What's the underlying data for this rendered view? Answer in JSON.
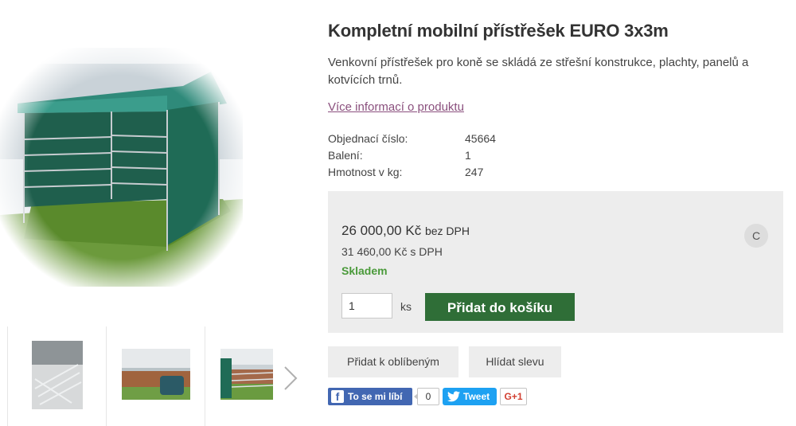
{
  "product": {
    "title": "Kompletní mobilní přístřešek EURO 3x3m",
    "description": "Venkovní přístřešek pro koně se skládá ze střešní konstrukce, plachty, panelů a kotvících trnů.",
    "more_info_link": "Více informací o produktu",
    "params": [
      {
        "label": "Objednací číslo:",
        "value": "45664"
      },
      {
        "label": "Balení:",
        "value": "1"
      },
      {
        "label": "Hmotnost v kg:",
        "value": "247"
      }
    ]
  },
  "price": {
    "net_amount": "26 000,00 Kč",
    "net_suffix": "bez DPH",
    "gross": "31 460,00 Kč s DPH",
    "availability": "Skladem",
    "badge": "C",
    "quantity_value": "1",
    "quantity_unit": "ks",
    "add_to_cart_label": "Přidat do košíku"
  },
  "actions": {
    "favorite_label": "Přidat k oblíbeným",
    "watch_price_label": "Hlídat slevu"
  },
  "social": {
    "fb_like_label": "To se mi líbí",
    "fb_count": "0",
    "tweet_label": "Tweet",
    "gplus_label": "G+1"
  },
  "colors": {
    "add_to_cart_bg": "#2f6e37",
    "stock_text": "#4a9a3a",
    "link": "#8a4f7d",
    "facebook": "#4267b2",
    "twitter": "#1da1f2"
  },
  "icons": {
    "thumbnail_next": "chevron-right-icon",
    "facebook": "facebook-icon",
    "twitter": "twitter-bird-icon"
  }
}
